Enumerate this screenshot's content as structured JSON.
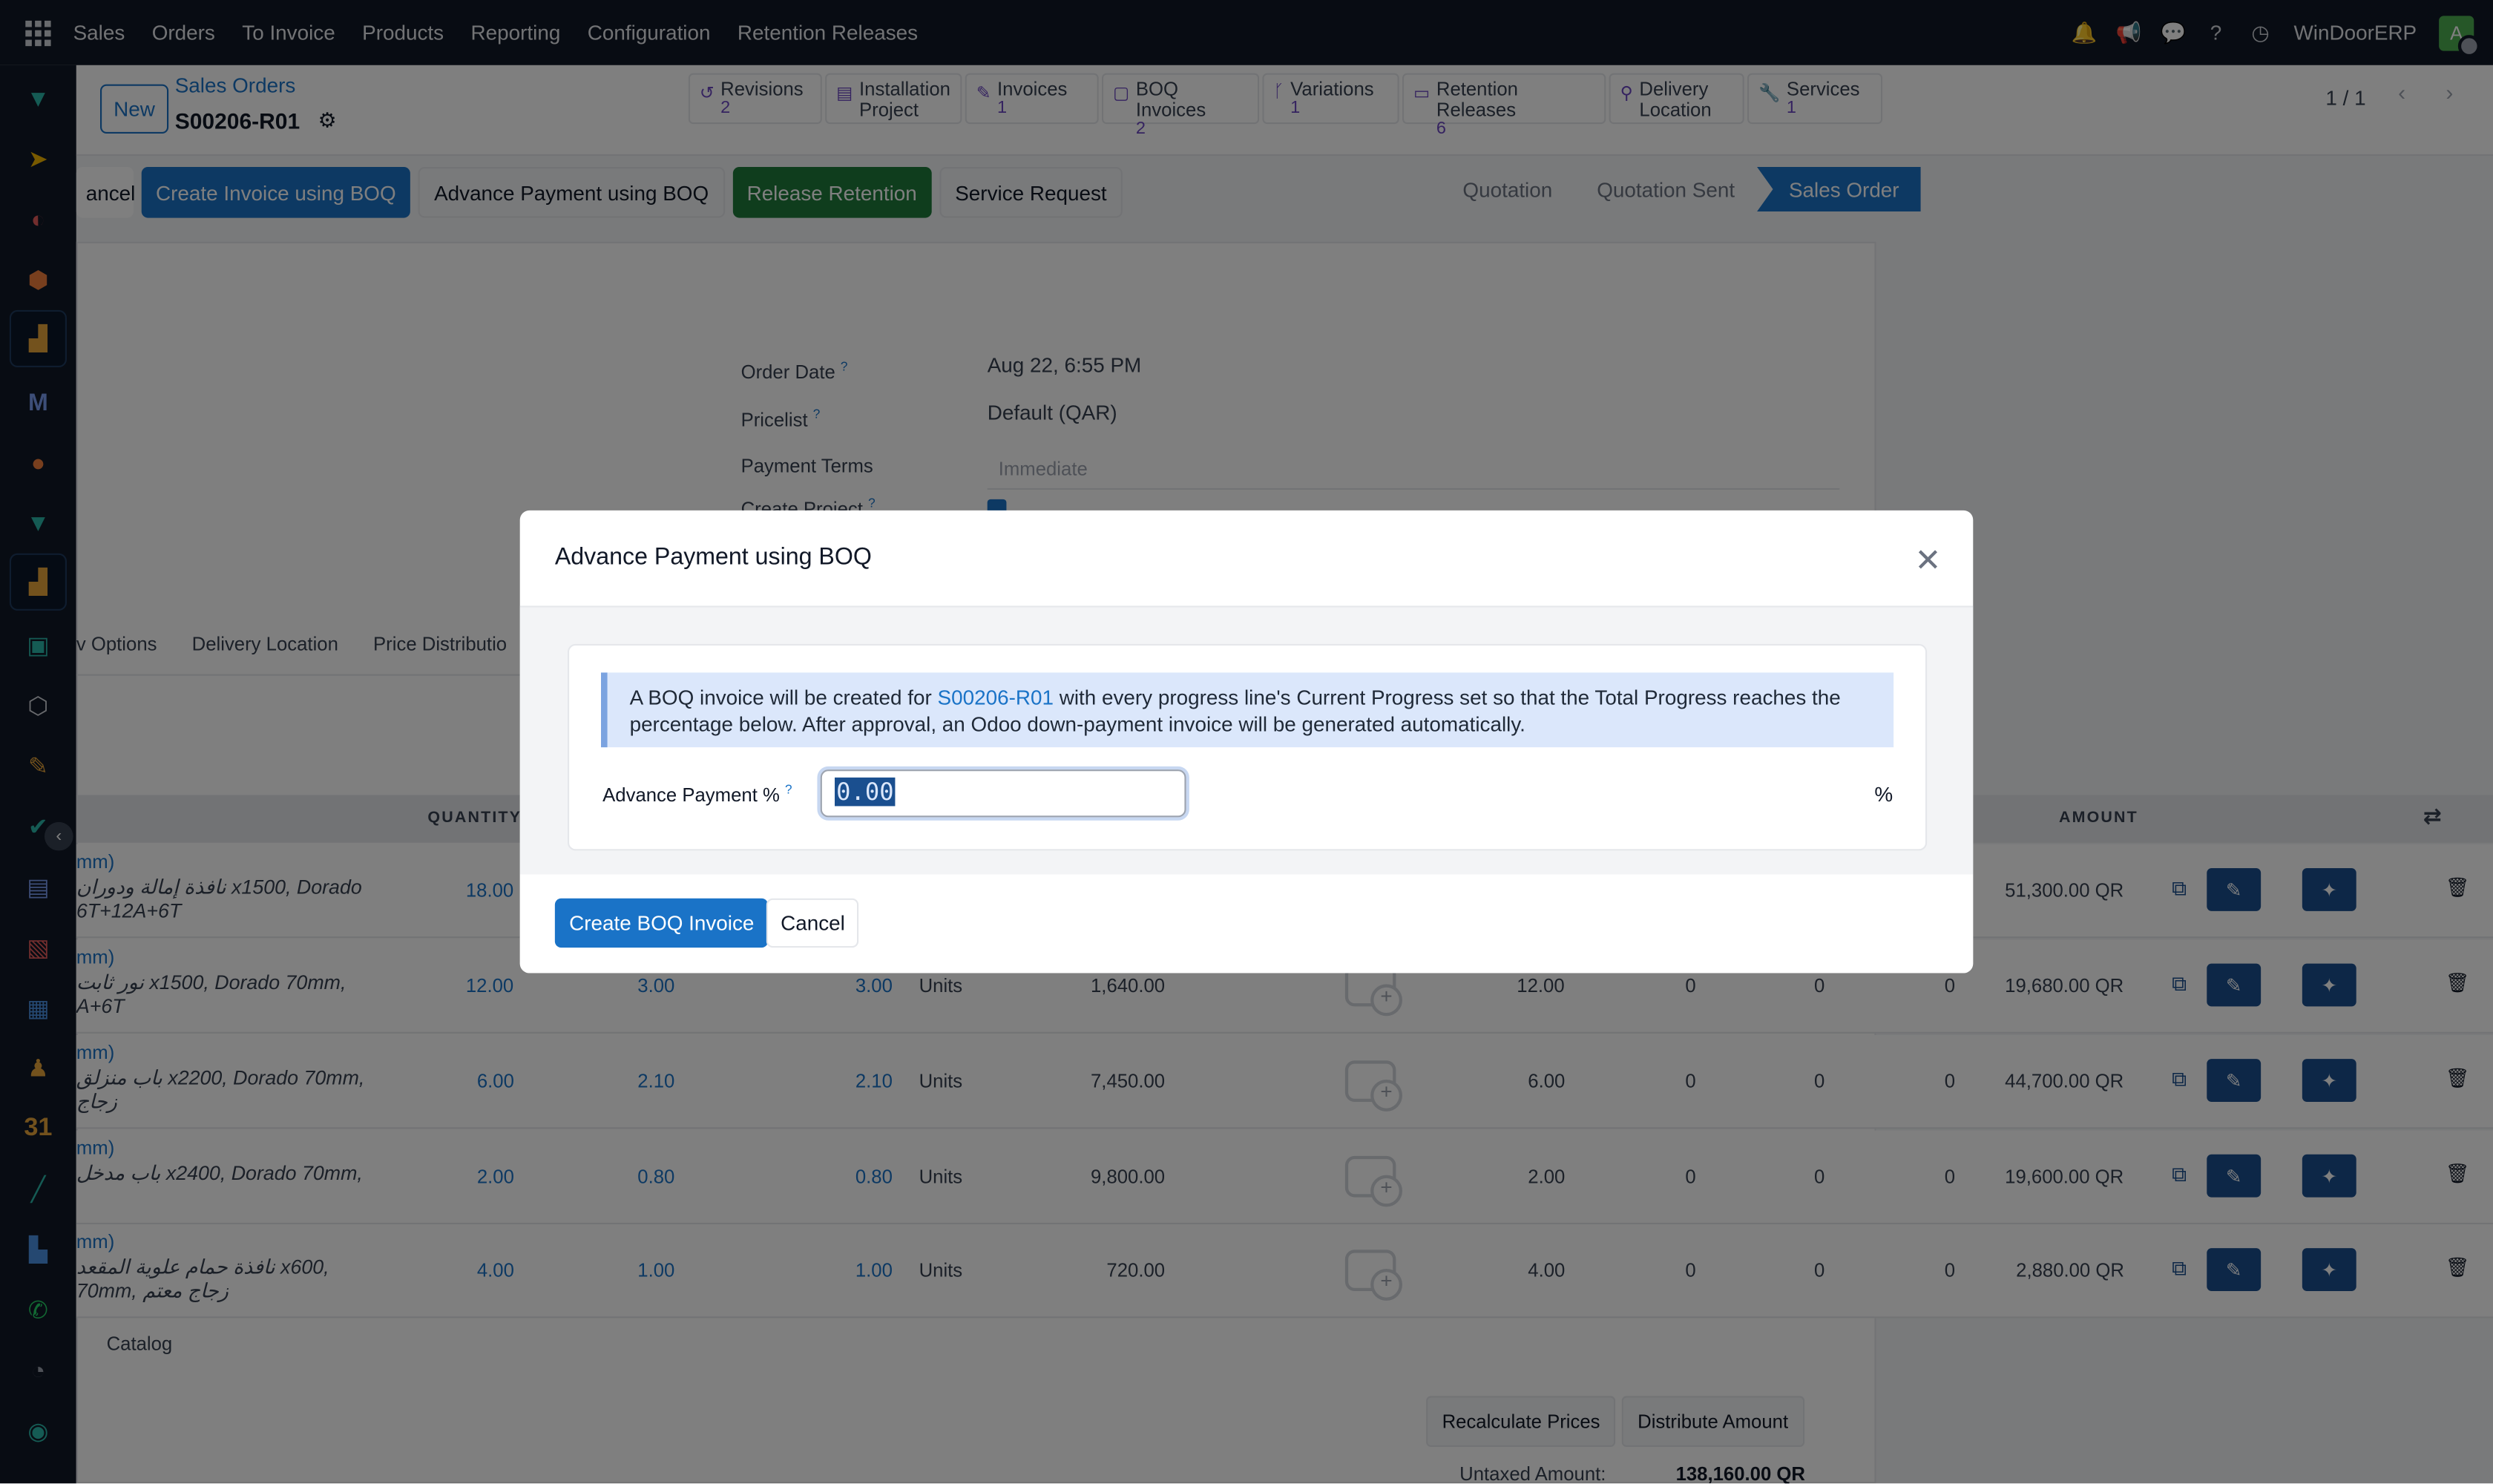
{
  "topbar": {
    "menu": [
      "Sales",
      "Orders",
      "To Invoice",
      "Products",
      "Reporting",
      "Configuration",
      "Retention Releases"
    ],
    "db_name": "WinDoorERP",
    "avatar": "A"
  },
  "control_panel": {
    "new_label": "New",
    "breadcrumb_parent": "Sales Orders",
    "record_name": "S00206-R01",
    "smart_buttons": [
      {
        "label": "Revisions",
        "count": "2",
        "icon": "history-icon"
      },
      {
        "label": "Installation Project",
        "count": "",
        "icon": "puzzle-icon"
      },
      {
        "label": "Invoices",
        "count": "1",
        "icon": "edit-icon"
      },
      {
        "label": "BOQ Invoices",
        "count": "2",
        "icon": "file-icon"
      },
      {
        "label": "Variations",
        "count": "1",
        "icon": "code-fork-icon"
      },
      {
        "label": "Retention Releases",
        "count": "6",
        "icon": "money-icon"
      },
      {
        "label": "Delivery Location",
        "count": "",
        "icon": "map-marker-icon"
      },
      {
        "label": "Services",
        "count": "1",
        "icon": "wrench-icon"
      }
    ],
    "pager": "1 / 1"
  },
  "status_bar": {
    "buttons": [
      "ancel",
      "Create Invoice using BOQ",
      "Advance Payment using BOQ",
      "Release Retention",
      "Service Request"
    ],
    "stages": [
      "Quotation",
      "Quotation Sent",
      "Sales Order"
    ],
    "active_stage": "Sales Order"
  },
  "form": {
    "order_date_label": "Order Date",
    "order_date": "Aug 22, 6:55 PM",
    "pricelist_label": "Pricelist",
    "pricelist": "Default (QAR)",
    "payment_terms_label": "Payment Terms",
    "payment_terms_placeholder": "Immediate",
    "create_project_label": "Create Project"
  },
  "tabs": [
    "v Options",
    "Delivery Location",
    "Price Distributio"
  ],
  "table": {
    "headers": {
      "quantity": "QUANTITY",
      "amount": "AMOUNT"
    },
    "rows": [
      {
        "head": "mm)",
        "desc": "نافذة إمالة ودوران x1500, Dorado 6T+12A+6T",
        "qty": "18.00",
        "c2": "",
        "c3": "",
        "uom": "",
        "price": "",
        "c5": "",
        "c6": "",
        "c7": "",
        "c8": "",
        "amount": "51,300.00 QR"
      },
      {
        "head": "mm)",
        "desc": "نور ثابت x1500, Dorado 70mm, A+6T",
        "qty": "12.00",
        "c2": "3.00",
        "c3": "3.00",
        "uom": "Units",
        "price": "1,640.00",
        "c5": "12.00",
        "c6": "0",
        "c7": "0",
        "c8": "0",
        "amount": "19,680.00 QR"
      },
      {
        "head": "mm)",
        "desc": "باب منزلق x2200, Dorado 70mm, زجاج",
        "qty": "6.00",
        "c2": "2.10",
        "c3": "2.10",
        "uom": "Units",
        "price": "7,450.00",
        "c5": "6.00",
        "c6": "0",
        "c7": "0",
        "c8": "0",
        "amount": "44,700.00 QR"
      },
      {
        "head": "mm)",
        "desc": "باب مدخل x2400, Dorado 70mm,",
        "qty": "2.00",
        "c2": "0.80",
        "c3": "0.80",
        "uom": "Units",
        "price": "9,800.00",
        "c5": "2.00",
        "c6": "0",
        "c7": "0",
        "c8": "0",
        "amount": "19,600.00 QR"
      },
      {
        "head": "mm)",
        "desc": "نافذة حمام علوية المقعد x600, 70mm, زجاج معتم",
        "qty": "4.00",
        "c2": "1.00",
        "c3": "1.00",
        "uom": "Units",
        "price": "720.00",
        "c5": "4.00",
        "c6": "0",
        "c7": "0",
        "c8": "0",
        "amount": "2,880.00 QR"
      }
    ],
    "catalog_label": "Catalog"
  },
  "totals": {
    "recalc_label": "Recalculate Prices",
    "distribute_label": "Distribute Amount",
    "untaxed_label": "Untaxed Amount:",
    "untaxed_value": "138,160.00 QR"
  },
  "modal": {
    "title": "Advance Payment using BOQ",
    "alert_prefix": "A BOQ invoice will be created for ",
    "alert_link": "S00206-R01",
    "alert_suffix": " with every progress line's Current Progress set so that the Total Progress reaches the percentage below. After approval, an Odoo down-payment invoice will be generated automatically.",
    "field_label": "Advance Payment %",
    "field_value": "0.00",
    "pct_symbol": "%",
    "create_label": "Create BOQ Invoice",
    "cancel_label": "Cancel"
  }
}
